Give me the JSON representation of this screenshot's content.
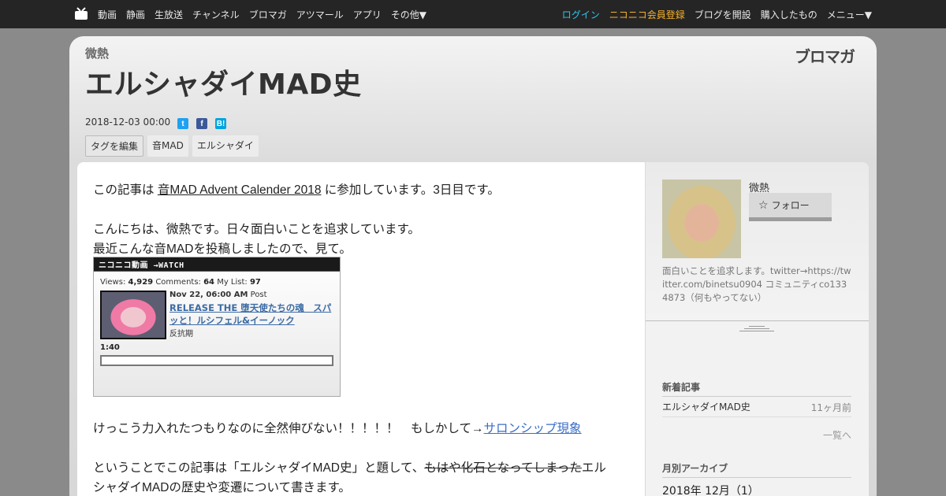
{
  "topbar": {
    "nav": [
      "動画",
      "静画",
      "生放送",
      "チャンネル",
      "ブロマガ",
      "アツマール",
      "アプリ",
      "その他▼"
    ],
    "login": "ログイン",
    "register": "ニコニコ会員登録",
    "open_blog": "ブログを開設",
    "purchased": "購入したもの",
    "menu": "メニュー▼"
  },
  "header": {
    "author": "微熱",
    "logo_text": "ブロマガ",
    "title": "エルシャダイMAD史",
    "date": "2018-12-03 00:00",
    "share": [
      "t",
      "f",
      "B!"
    ],
    "tag_edit": "タグを編集",
    "tags": [
      "音MAD",
      "エルシャダイ"
    ]
  },
  "article": {
    "p1_before": "この記事は ",
    "p1_link": "音MAD Advent Calender 2018",
    "p1_after": " に参加しています。3日目です。",
    "p2": "こんにちは、微熱です。日々面白いことを追求しています。",
    "p3": "最近こんな音MADを投稿しましたので、見て。",
    "p4_before": "けっこう力入れたつもりなのに全然伸びない！！！！！　もしかして→",
    "p4_link": "サロンシップ現象",
    "p5_before": "ということでこの記事は「エルシャダイMAD史」と題して、",
    "p5_strike": "もはや化石となってしまった",
    "p5_after": "エル",
    "p6": "シャダイMADの歴史や変遷について書きます。"
  },
  "embed": {
    "header": "ニコニコ動画 →WATCH",
    "views_label": "Views:",
    "views": "4,929",
    "comments_label": "Comments:",
    "comments": "64",
    "mylist_label": "My List:",
    "mylist": "97",
    "date": "Nov 22, 06:00 AM",
    "date_suffix": "Post",
    "title": "RELEASE THE 堕天使たちの魂　スパッと！ルシフェル&イーノック",
    "user": "反抗期",
    "length": "1:40"
  },
  "sidebar": {
    "name": "微熱",
    "follow": "フォロー",
    "description": "面白いことを追求します。twitter→https://twitter.com/binetsu0904 コミュニティco1334873（何もやってない）",
    "new_posts_head": "新着記事",
    "new_posts": [
      {
        "title": "エルシャダイMAD史",
        "date": "11ヶ月前"
      }
    ],
    "more": "一覧へ",
    "archive_head": "月別アーカイブ",
    "archive": [
      "2018年 12月（1）"
    ]
  }
}
